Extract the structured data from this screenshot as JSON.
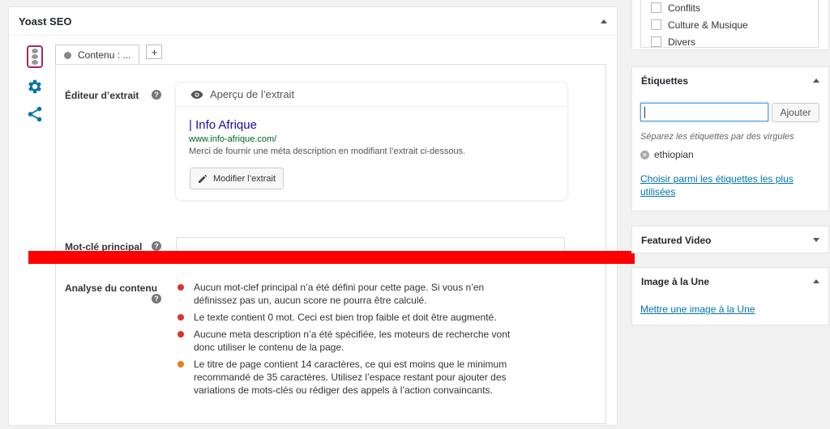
{
  "yoast": {
    "title": "Yoast SEO",
    "tab_label": "Contenu : ...",
    "add_tab_label": "+",
    "extract_editor_label": "Éditeur d’extrait",
    "help_glyph": "?",
    "snippet": {
      "header": "Aperçu de l’extrait",
      "title": "| Info Afrique",
      "url": "www.info-afrique.com/",
      "description": "Merci de fournir une méta description en modifiant l’extrait ci-dessous.",
      "edit_button": "Modifier l’extrait"
    },
    "keyword_label": "Mot-clé principal",
    "keyword_value": "",
    "analysis_label": "Analyse du contenu",
    "analysis_items": [
      {
        "status": "red",
        "lines": [
          "Aucun mot-clef principal n’a été défini pour cette page. Si vous n’en",
          "définissez pas un, aucun score ne pourra être calculé."
        ]
      },
      {
        "status": "red",
        "lines": [
          "Le texte contient 0 mot. Ceci est bien trop faible et doit être augmenté."
        ]
      },
      {
        "status": "red",
        "lines": [
          "Aucune meta description n’a été spécifiée, les moteurs de recherche vont",
          "donc utiliser le contenu de la page."
        ]
      },
      {
        "status": "orange",
        "lines": [
          "Le titre de page contient 14 caractères, ce qui est moins que le minimum",
          "recommandé de 35 caractères. Utilisez l’espace restant pour ajouter des",
          "variations de mots-clés ou rédiger des appels à l’action convaincants."
        ]
      }
    ]
  },
  "categories": {
    "items": [
      "Conflits",
      "Culture & Musique",
      "Divers"
    ]
  },
  "tags": {
    "title": "Étiquettes",
    "input_value": "",
    "add_button": "Ajouter",
    "hint": "Séparez les étiquettes par des virgules",
    "remove_glyph": "×",
    "existing_tag": "ethiopian",
    "choose_link": "Choisir parmi les étiquettes les plus utilisées"
  },
  "featured_video": {
    "title": "Featured Video"
  },
  "featured_image": {
    "title": "Image à la Une",
    "link": "Mettre une image à la Une"
  },
  "colors": {
    "red": "#dc3232",
    "orange": "#ee7c1b",
    "yoast_purple": "#a4286a",
    "link_blue": "#0073aa",
    "icon_blue": "#0073aa",
    "annotation_red": "#ff0000"
  },
  "icons": [
    "traffic-light-icon",
    "gear-icon",
    "share-icon",
    "eye-icon",
    "pencil-icon",
    "remove-tag-icon",
    "help-icon"
  ]
}
